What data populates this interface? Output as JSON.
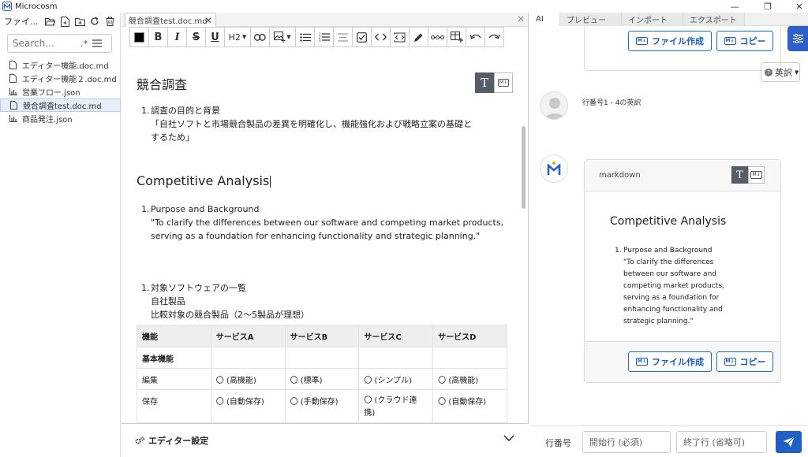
{
  "window": {
    "title": "Microcosm",
    "minimize": "—",
    "restore": "❐",
    "close": "✕"
  },
  "sidebar": {
    "label": "ファイ...",
    "search_placeholder": "Search...",
    "search_option": ".*",
    "files": [
      {
        "name": "エディター機能.doc.md",
        "icon": "file-icon"
      },
      {
        "name": "エディター機能２.doc.md",
        "icon": "file-icon"
      },
      {
        "name": "営業フロー.json",
        "icon": "chart-icon"
      },
      {
        "name": "競合調査test.doc.md",
        "icon": "file-icon",
        "active": true
      },
      {
        "name": "商品発注.json",
        "icon": "chart-icon"
      }
    ]
  },
  "editor": {
    "tab_title": "競合調査test.doc.md",
    "tab_close": "✕",
    "pane_close": "✕",
    "toolbar": {
      "bold": "B",
      "italic": "I",
      "strike": "S",
      "underline": "U",
      "heading": "H2"
    },
    "doc": {
      "h1_ja": "競合調査",
      "p1_num": "1.",
      "p1_title": "調査の目的と背景",
      "p1_line1": "「自社ソフトと市場競合製品の差異を明確化し、機能強化および戦略立案の基礎と",
      "p1_line2": "するため」",
      "h1_en": "Competitive Analysis",
      "p2_num": "1.",
      "p2_title": "Purpose and Background",
      "p2_line1": "\"To clarify the differences between our software and competing market products,",
      "p2_line2": "serving as a foundation for enhancing functionality and strategic planning.\"",
      "p3_num": "1.",
      "p3_title": "対象ソフトウェアの一覧",
      "p3_line1": "自社製品",
      "p3_line2": "比較対象の競合製品（2〜5製品が理想）"
    },
    "table": {
      "headers": [
        "機能",
        "サービスA",
        "サービスB",
        "サービスC",
        "サービスD"
      ],
      "rows": [
        [
          "基本機能",
          "",
          "",
          "",
          ""
        ],
        [
          "編集",
          "〇 (高機能)",
          "〇 (標準)",
          "〇 (シンプル)",
          "〇 (高機能)"
        ],
        [
          "保存",
          "〇 (自動保存)",
          "〇 (手動保存)",
          "〇 (クラウド連携)",
          "〇 (自動保存)"
        ]
      ]
    },
    "settings_label": "エディター設定"
  },
  "right": {
    "tabs": [
      "AI",
      "プレビュー",
      "インポート",
      "エクスポート"
    ],
    "file_create": "ファイル作成",
    "copy": "コピー",
    "lang": "英訳",
    "user_message": "行番号1 - 4の英訳",
    "card_label": "markdown",
    "card_title": "Competitive Analysis",
    "card_num": "1.",
    "card_p_title": "Purpose and Background",
    "card_lines": [
      "\"To clarify the differences",
      "between our software and",
      "competing market products,",
      "serving as a foundation for",
      "enhancing functionality and",
      "strategic planning.\""
    ],
    "line_label": "行番号",
    "start_placeholder": "開始行 (必須)",
    "end_placeholder": "終了行 (省略可)"
  },
  "colors": {
    "accent": "#1f5fc6",
    "active_file_bg": "#e5eefb"
  }
}
